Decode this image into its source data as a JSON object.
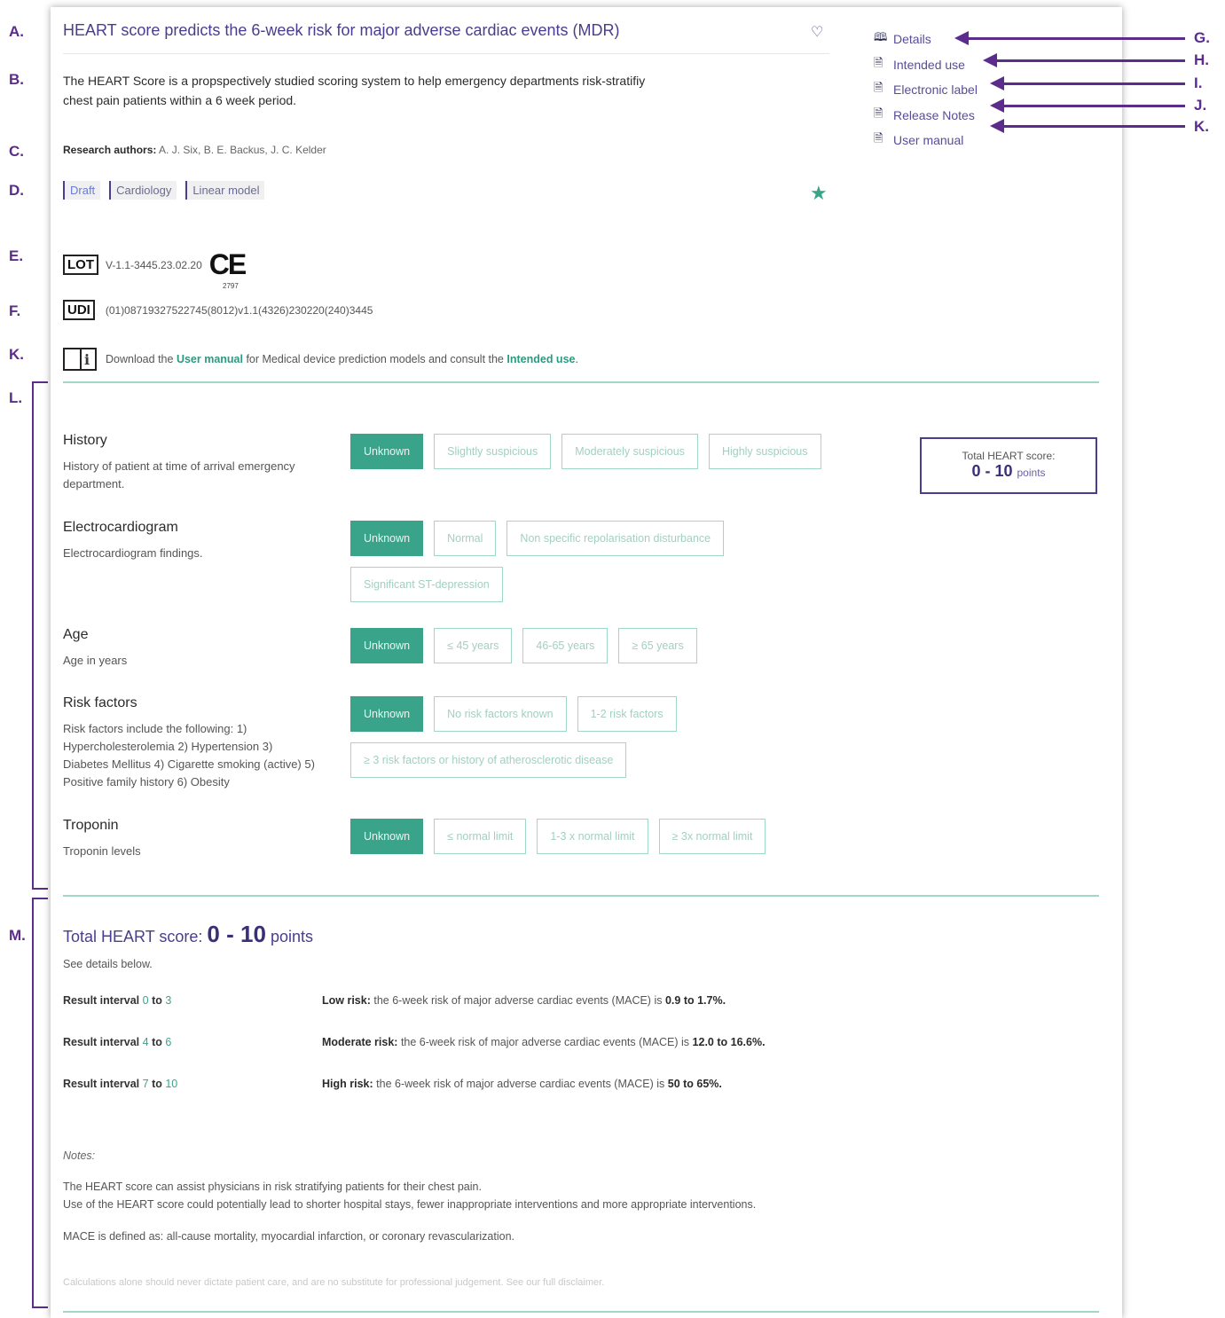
{
  "annotations": {
    "left": [
      "A.",
      "B.",
      "C.",
      "D.",
      "E.",
      "F.",
      "K.",
      "L.",
      "M."
    ],
    "right": [
      "G.",
      "H.",
      "I.",
      "J.",
      "K."
    ]
  },
  "header": {
    "title": "HEART score predicts the 6-week risk for major adverse cardiac events (MDR)",
    "description": "The HEART Score is a propspectively studied scoring system to help emergency departments risk-stratifiy chest pain patients within a 6 week period.",
    "authors_label": "Research authors:",
    "authors": "A. J. Six, B. E. Backus, J. C. Kelder",
    "tags": [
      "Draft",
      "Cardiology",
      "Linear model"
    ]
  },
  "side_links": [
    {
      "label": "Details",
      "icon": "book-open-icon"
    },
    {
      "label": "Intended use",
      "icon": "document-icon"
    },
    {
      "label": "Electronic label",
      "icon": "document-icon"
    },
    {
      "label": "Release Notes",
      "icon": "document-icon"
    },
    {
      "label": "User manual",
      "icon": "document-icon"
    }
  ],
  "regulatory": {
    "lot_symbol": "LOT",
    "lot_value": "V-1.1-3445.23.02.20",
    "ce_mark": "CE",
    "ce_number": "2797",
    "udi_symbol": "UDI",
    "udi_value": "(01)08719327522745(8012)v1.1(4326)230220(240)3445",
    "manual_pre": "Download the",
    "manual_link": "User manual",
    "manual_mid": "for Medical device prediction models and consult the",
    "intended_link": "Intended use",
    "manual_end": "."
  },
  "questions": [
    {
      "title": "History",
      "desc": "History of patient at time of arrival emergency department.",
      "options": [
        "Unknown",
        "Slightly suspicious",
        "Moderately suspicious",
        "Highly suspicious"
      ]
    },
    {
      "title": "Electrocardiogram",
      "desc": "Electrocardiogram findings.",
      "options": [
        "Unknown",
        "Normal",
        "Non specific repolarisation disturbance",
        "Significant ST-depression"
      ]
    },
    {
      "title": "Age",
      "desc": "Age in years",
      "options": [
        "Unknown",
        "≤ 45 years",
        "46-65 years",
        "≥ 65 years"
      ]
    },
    {
      "title": "Risk factors",
      "desc": "Risk factors include the following: 1) Hypercholesterolemia 2) Hypertension 3) Diabetes Mellitus 4) Cigarette smoking (active) 5) Positive family history 6) Obesity",
      "options": [
        "Unknown",
        "No risk factors known",
        "1-2 risk factors",
        "≥ 3 risk factors or history of atherosclerotic disease"
      ]
    },
    {
      "title": "Troponin",
      "desc": "Troponin levels",
      "options": [
        "Unknown",
        "≤ normal limit",
        "1-3 x normal limit",
        "≥ 3x normal limit"
      ]
    }
  ],
  "score_box": {
    "label": "Total HEART score:",
    "value": "0 - 10",
    "unit": "points"
  },
  "total": {
    "label": "Total HEART score:",
    "value": "0 - 10",
    "unit": "points",
    "see_details": "See details below."
  },
  "results": [
    {
      "interval_label": "Result interval",
      "from": "0",
      "to_word": "to",
      "to": "3",
      "risk_label": "Low risk:",
      "risk_text": "the 6-week risk of major adverse cardiac events (MACE) is",
      "risk_value": "0.9 to 1.7%."
    },
    {
      "interval_label": "Result interval",
      "from": "4",
      "to_word": "to",
      "to": "6",
      "risk_label": "Moderate risk:",
      "risk_text": "the 6-week risk of major adverse cardiac events (MACE) is",
      "risk_value": "12.0 to 16.6%."
    },
    {
      "interval_label": "Result interval",
      "from": "7",
      "to_word": "to",
      "to": "10",
      "risk_label": "High risk:",
      "risk_text": "the 6-week risk of major adverse cardiac events (MACE) is",
      "risk_value": "50 to 65%."
    }
  ],
  "notes": {
    "label": "Notes:",
    "line1": "The HEART score can assist physicians in risk stratifying patients for their chest pain.",
    "line2": "Use of the HEART score could potentially lead to shorter hospital stays, fewer inappropriate interventions and more appropriate interventions.",
    "line3": "MACE is defined as: all-cause mortality, myocardial infarction, or coronary revascularization.",
    "disclaimer": "Calculations alone should never dictate patient care, and are no substitute for professional judgement. See our full disclaimer."
  },
  "colors": {
    "accent": "#3aa48b",
    "brand": "#4a3d8f",
    "annotation": "#5b2c8c"
  }
}
